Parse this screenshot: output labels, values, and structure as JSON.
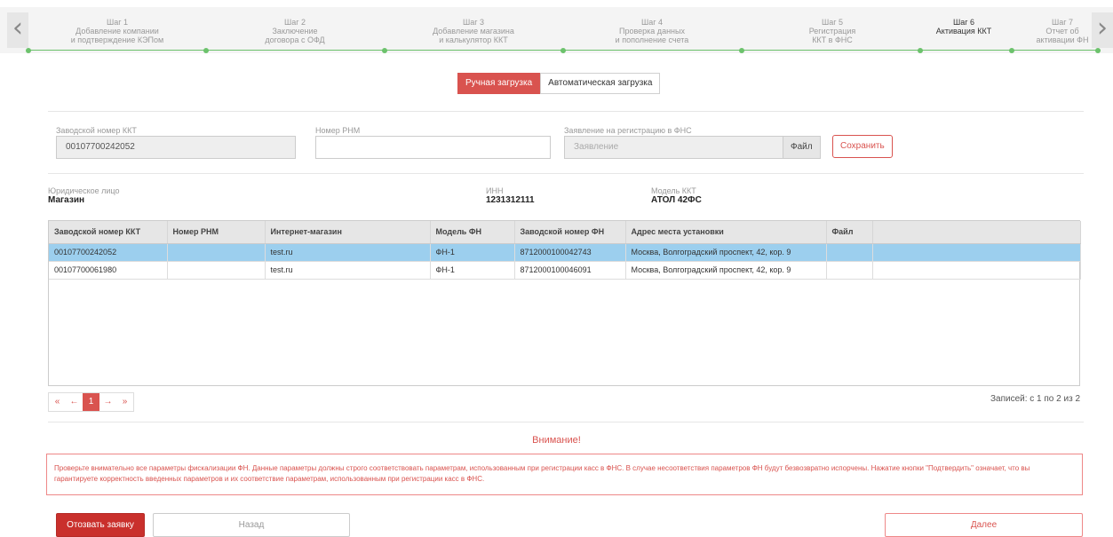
{
  "stepper": {
    "prev_icon": "chevron-left-icon",
    "next_icon": "chevron-right-icon",
    "steps": [
      {
        "num": "Шаг 1",
        "l1": "Добавление компании",
        "l2": "и подтверждение КЭПом"
      },
      {
        "num": "Шаг 2",
        "l1": "Заключение",
        "l2": "договора с ОФД"
      },
      {
        "num": "Шаг 3",
        "l1": "Добавление магазина",
        "l2": "и калькулятор ККТ"
      },
      {
        "num": "Шаг 4",
        "l1": "Проверка данных",
        "l2": "и пополнение счета"
      },
      {
        "num": "Шаг 5",
        "l1": "Регистрация",
        "l2": "ККТ в ФНС"
      },
      {
        "num": "Шаг 6",
        "l1": "Активация ККТ",
        "l2": ""
      },
      {
        "num": "Шаг 7",
        "l1": "Отчет об",
        "l2": "активации ФН"
      }
    ],
    "active_step": "Шаг 6",
    "line_color": "#6cc26c"
  },
  "tabs": {
    "manual": "Ручная загрузка",
    "auto": "Автоматическая загрузка"
  },
  "form": {
    "kkt_label": "Заводской номер ККТ",
    "kkt_value": "00107700242052",
    "rnm_label": "Номер РНМ",
    "rnm_value": "",
    "statement_label": "Заявление на регистрацию в ФНС",
    "statement_placeholder": "Заявление",
    "file_button": "Файл",
    "save_button": "Сохранить"
  },
  "info": {
    "entity_label": "Юридическое лицо",
    "entity_value": "Магазин",
    "inn_label": "ИНН",
    "inn_value": "1231312111",
    "model_label": "Модель ККТ",
    "model_value": "АТОЛ 42ФС"
  },
  "table": {
    "headers": [
      "Заводской номер ККТ",
      "Номер РНМ",
      "Интернет-магазин",
      "Модель ФН",
      "Заводской номер ФН",
      "Адрес места установки",
      "Файл",
      ""
    ],
    "rows": [
      [
        "00107700242052",
        "",
        "test.ru",
        "ФН-1",
        "8712000100042743",
        "Москва, Волгоградский проспект, 42, кор. 9",
        "",
        ""
      ],
      [
        "00107700061980",
        "",
        "test.ru",
        "ФН-1",
        "8712000100046091",
        "Москва, Волгоградский проспект, 42, кор. 9",
        "",
        ""
      ]
    ],
    "selected_row_color": "#9ccfee"
  },
  "pager": {
    "first": "«",
    "prev": "←",
    "current": "1",
    "next": "→",
    "last": "»",
    "records": "Записей: с 1 по 2 из 2"
  },
  "warning": {
    "title": "Внимание!",
    "text": "Проверьте внимательно все параметры фискализации ФН. Данные параметры должны строго соответствовать параметрам, использованным при регистрации касс в ФНС. В случае несоответствия параметров ФН будут безвозвратно испорчены. Нажатие кнопки \"Подтвердить\" означает, что вы гарантируете корректность введенных параметров и их соответствие параметрам, использованным при регистрации касс в ФНС."
  },
  "actions": {
    "revoke": "Отозвать заявку",
    "back": "Назад",
    "next": "Далее"
  },
  "colors": {
    "accent": "#d9534f",
    "revoke_bg": "#c9302c"
  }
}
